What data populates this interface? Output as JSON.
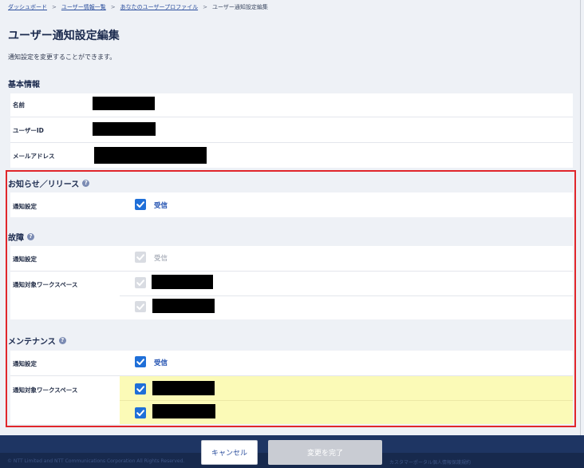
{
  "breadcrumb": {
    "items": [
      "ダッシュボード",
      "ユーザー情報一覧",
      "あなたのユーザープロファイル"
    ],
    "current": "ユーザー通知設定編集",
    "separator": ">"
  },
  "page": {
    "title": "ユーザー通知設定編集",
    "description": "通知設定を変更することができます。"
  },
  "basic_info": {
    "title": "基本情報",
    "fields": [
      {
        "label": "名前",
        "value_redacted": true
      },
      {
        "label": "ユーザーID",
        "value_redacted": true
      },
      {
        "label": "メールアドレス",
        "value_redacted": true
      }
    ]
  },
  "sections": {
    "news": {
      "title": "お知らせ／リリース",
      "help_icon": "question-icon",
      "setting_label": "通知設定",
      "receive_label": "受信",
      "receive_checked": true
    },
    "fault": {
      "title": "故障",
      "help_icon": "question-icon",
      "setting_label": "通知設定",
      "receive_label": "受信",
      "receive_checked": true,
      "receive_disabled": true,
      "workspace_label": "通知対象ワークスペース",
      "workspaces": [
        {
          "checked": true,
          "disabled": true,
          "name_redacted": true
        },
        {
          "checked": true,
          "disabled": true,
          "name_redacted": true
        }
      ]
    },
    "maintenance": {
      "title": "メンテナンス",
      "help_icon": "question-icon",
      "setting_label": "通知設定",
      "receive_label": "受信",
      "receive_checked": true,
      "workspace_label": "通知対象ワークスペース",
      "workspaces": [
        {
          "checked": true,
          "name_redacted": true
        },
        {
          "checked": true,
          "name_redacted": true
        }
      ]
    }
  },
  "footer": {
    "cancel_label": "キャンセル",
    "complete_label": "変更を完了",
    "copyright": "© NTT Limited and NTT Communications Corporation All Rights Reserved.",
    "portal_link": "カスタマーポータル個人情報保護規約"
  },
  "colors": {
    "accent": "#1f6fd8",
    "highlight_frame": "#e0262b",
    "highlight_fill": "#fbfab7",
    "footer": "#1e3563"
  }
}
